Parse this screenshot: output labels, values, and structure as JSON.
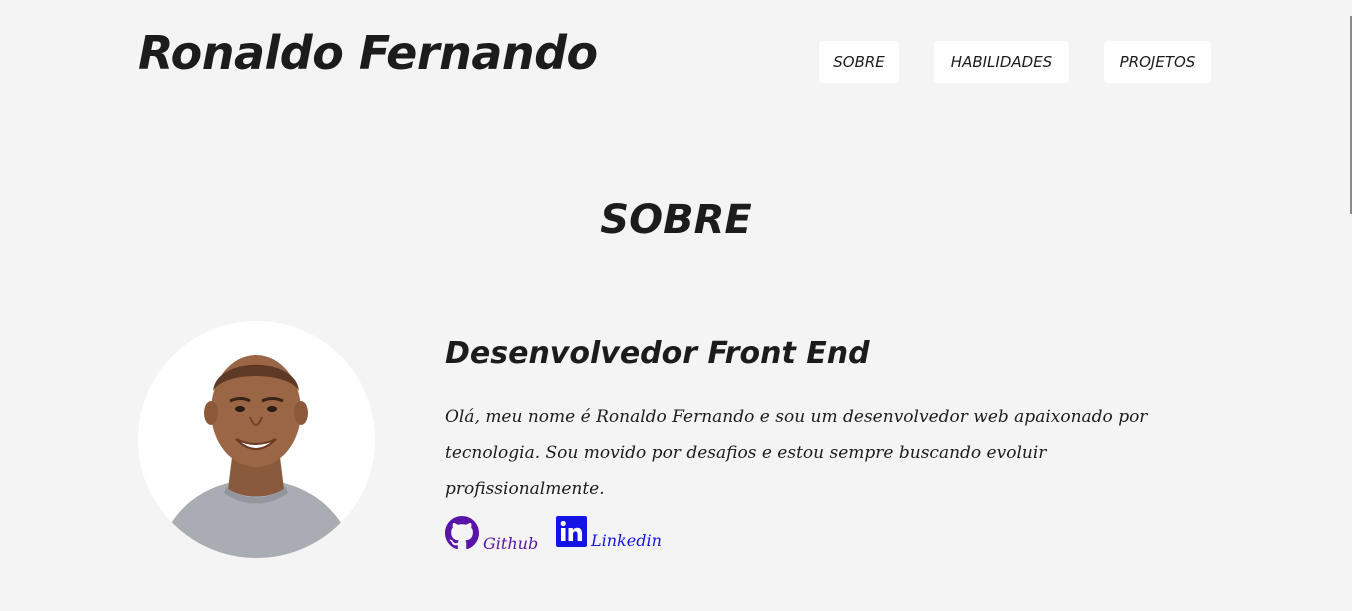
{
  "header": {
    "brand": "Ronaldo Fernando",
    "nav": [
      {
        "label": "SOBRE"
      },
      {
        "label": "HABILIDADES"
      },
      {
        "label": "PROJETOS"
      }
    ]
  },
  "about": {
    "section_title": "SOBRE",
    "role": "Desenvolvedor Front End",
    "bio": "Olá, meu nome é Ronaldo Fernando e sou um desenvolvedor web apaixonado por tecnologia. Sou movido por desafios e estou sempre buscando evoluir profissionalmente.",
    "links": [
      {
        "label": "Github",
        "icon": "github-icon",
        "color": "#5a14a8"
      },
      {
        "label": "Linkedin",
        "icon": "linkedin-icon",
        "color": "#1414e6"
      }
    ]
  },
  "colors": {
    "background": "#f4f4f4",
    "nav_button_bg": "#ffffff",
    "text": "#1c1c1c"
  }
}
